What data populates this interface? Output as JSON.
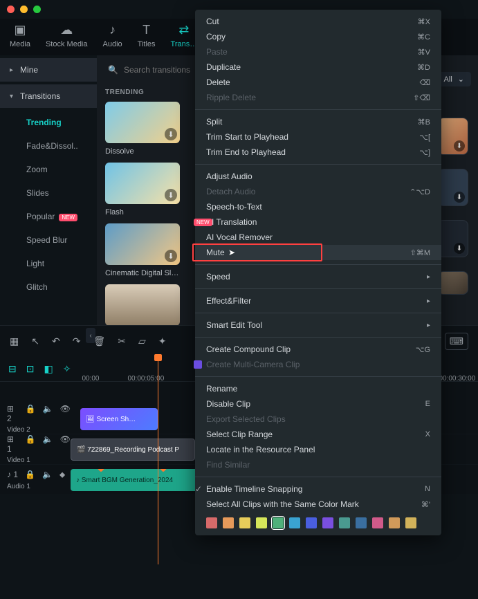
{
  "tabs": {
    "media": "Media",
    "stock": "Stock Media",
    "audio": "Audio",
    "titles": "Titles",
    "transitions": "Trans…"
  },
  "sidebar": {
    "mine": "Mine",
    "transitions": "Transitions",
    "items": [
      "Trending",
      "Fade&Dissol..",
      "Zoom",
      "Slides",
      "Popular",
      "Speed Blur",
      "Light",
      "Glitch"
    ]
  },
  "search": {
    "placeholder": "Search transitions"
  },
  "all_label": "All",
  "section_label": "TRENDING",
  "cards": {
    "c0": "Dissolve",
    "c1": "Flash",
    "c2": "Cinematic Digital Slid…"
  },
  "ruler": {
    "t0": "00:00",
    "t1": "00:00:05:00",
    "t2": "00:00:30:00"
  },
  "tracks": {
    "v2b": "⊞ 2",
    "v2l": "Video 2",
    "v1b": "⊞ 1",
    "v1l": "Video 1",
    "a1b": "♪ 1",
    "a1l": "Audio 1"
  },
  "clips": {
    "screen": "Screen Sh…",
    "podcast": "722869_Recording Podcast P",
    "bgm": "Smart BGM Generation_2024"
  },
  "ctx": {
    "cut": {
      "l": "Cut",
      "s": "⌘X"
    },
    "copy": {
      "l": "Copy",
      "s": "⌘C"
    },
    "paste": {
      "l": "Paste",
      "s": "⌘V"
    },
    "dup": {
      "l": "Duplicate",
      "s": "⌘D"
    },
    "del": {
      "l": "Delete",
      "s": "⌫"
    },
    "rdel": {
      "l": "Ripple Delete",
      "s": "⇧⌫"
    },
    "split": {
      "l": "Split",
      "s": "⌘B"
    },
    "tstart": {
      "l": "Trim Start to Playhead",
      "s": "⌥["
    },
    "tend": {
      "l": "Trim End to Playhead",
      "s": "⌥]"
    },
    "adjaudio": {
      "l": "Adjust Audio"
    },
    "detach": {
      "l": "Detach Audio",
      "s": "⌃⌥D"
    },
    "stt": {
      "l": "Speech-to-Text"
    },
    "aitrans": {
      "l": "AI Translation"
    },
    "vocal": {
      "l": "AI Vocal Remover"
    },
    "mute": {
      "l": "Mute",
      "s": "⇧⌘M"
    },
    "speed": {
      "l": "Speed"
    },
    "eff": {
      "l": "Effect&Filter"
    },
    "smart": {
      "l": "Smart Edit Tool"
    },
    "compound": {
      "l": "Create Compound Clip",
      "s": "⌥G"
    },
    "multicam": {
      "l": "Create Multi-Camera Clip"
    },
    "rename": {
      "l": "Rename"
    },
    "disable": {
      "l": "Disable Clip",
      "s": "E"
    },
    "export": {
      "l": "Export Selected Clips"
    },
    "range": {
      "l": "Select Clip Range",
      "s": "X"
    },
    "locate": {
      "l": "Locate in the Resource Panel"
    },
    "similar": {
      "l": "Find Similar"
    },
    "snap": {
      "l": "Enable Timeline Snapping",
      "s": "N"
    },
    "selcolor": {
      "l": "Select All Clips with the Same Color Mark",
      "s": "⌘'"
    }
  },
  "colors": [
    "#d76a6a",
    "#e69a5a",
    "#e6cc5a",
    "#d6e65a",
    "#4fb07a",
    "#3aa3d1",
    "#4a5fe0",
    "#7a4fe0",
    "#4a9a90",
    "#3a6fa0",
    "#d15a8a",
    "#d19a5a",
    "#d1b25a"
  ]
}
